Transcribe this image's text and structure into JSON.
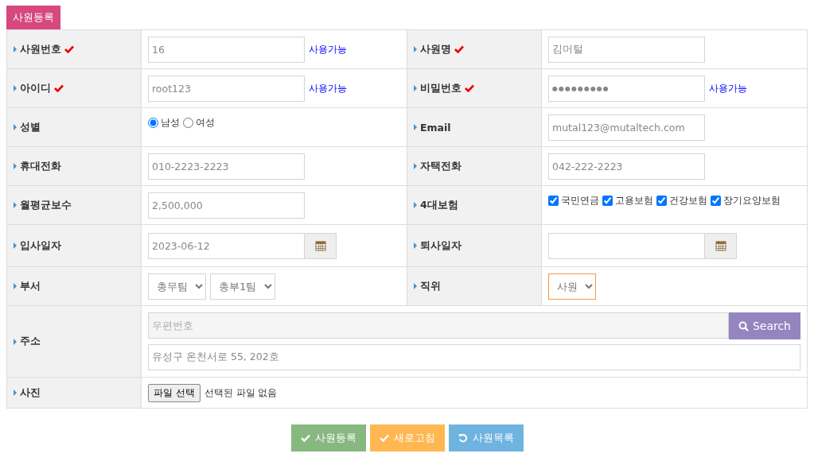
{
  "title": "사원등록",
  "rows": [
    {
      "fields": [
        {
          "label": "사원번호",
          "required": true,
          "kind": "text",
          "value": "16",
          "note": "사용가능"
        },
        {
          "label": "사원명",
          "required": true,
          "kind": "text",
          "value": "김머털"
        }
      ]
    },
    {
      "fields": [
        {
          "label": "아이디",
          "required": true,
          "kind": "text",
          "value": "root123",
          "note": "사용가능"
        },
        {
          "label": "비밀번호",
          "required": true,
          "kind": "password",
          "value": "●●●●●●●●●",
          "note": "사용가능"
        }
      ]
    },
    {
      "fields": [
        {
          "label": "성별",
          "required": false,
          "kind": "radio",
          "options": [
            {
              "label": "남성",
              "selected": true
            },
            {
              "label": "여성",
              "selected": false
            }
          ]
        },
        {
          "label": "Email",
          "required": false,
          "kind": "text",
          "value": "mutal123@mutaltech.com"
        }
      ]
    },
    {
      "fields": [
        {
          "label": "휴대전화",
          "required": false,
          "kind": "text",
          "value": "010-2223-2223"
        },
        {
          "label": "자택전화",
          "required": false,
          "kind": "text",
          "value": "042-222-2223"
        }
      ]
    },
    {
      "fields": [
        {
          "label": "월평균보수",
          "required": false,
          "kind": "text",
          "value": "2,500,000"
        },
        {
          "label": "4대보험",
          "required": false,
          "kind": "checkbox",
          "options": [
            {
              "label": "국민연금",
              "checked": true
            },
            {
              "label": "고용보험",
              "checked": true
            },
            {
              "label": "건강보험",
              "checked": true
            },
            {
              "label": "장기요양보험",
              "checked": true
            }
          ]
        }
      ]
    },
    {
      "fields": [
        {
          "label": "입사일자",
          "required": false,
          "kind": "date",
          "value": "2023-06-12"
        },
        {
          "label": "퇴사일자",
          "required": false,
          "kind": "date"
        }
      ]
    },
    {
      "fields": [
        {
          "label": "부서",
          "required": false,
          "kind": "select",
          "selects": [
            {
              "value": "총무팀",
              "focused": false
            },
            {
              "value": "총부1팀",
              "focused": false
            }
          ]
        },
        {
          "label": "직위",
          "required": false,
          "kind": "select",
          "selects": [
            {
              "value": "사원",
              "focused": true
            }
          ]
        }
      ]
    },
    {
      "fields": [
        {
          "label": "주소",
          "required": false,
          "kind": "address",
          "placeholder": "우편번호",
          "button": "Search",
          "value": "유성구 온천서로 55, 202호"
        }
      ]
    },
    {
      "fields": [
        {
          "label": "사진",
          "required": false,
          "kind": "file",
          "button": "파일 선택",
          "status": "선택된 파일 없음"
        }
      ]
    }
  ],
  "buttons": [
    {
      "label": "사원등록",
      "kind": "submit"
    },
    {
      "label": "새로고침",
      "kind": "reset"
    },
    {
      "label": "사원목록",
      "kind": "list"
    }
  ]
}
